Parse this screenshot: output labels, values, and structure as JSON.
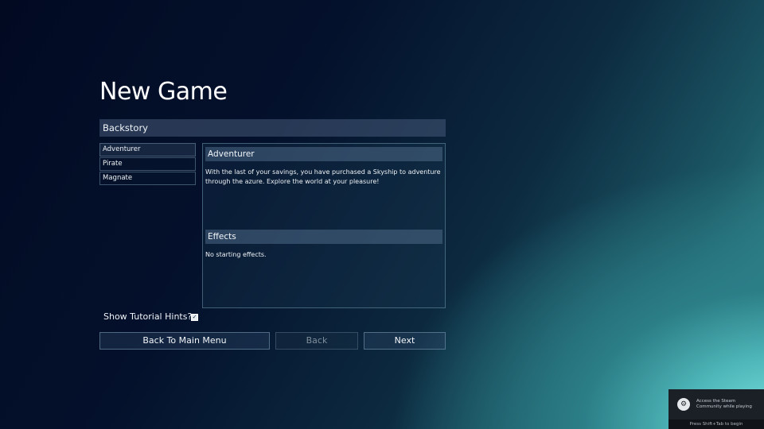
{
  "page": {
    "title": "New Game",
    "section_header": "Backstory"
  },
  "backstories": [
    {
      "label": "Adventurer",
      "selected": true
    },
    {
      "label": "Pirate",
      "selected": false
    },
    {
      "label": "Magnate",
      "selected": false
    }
  ],
  "detail": {
    "header": "Adventurer",
    "description": "With the last of your savings, you have purchased a Skyship to adventure through the azure. Explore the world at your pleasure!",
    "effects_header": "Effects",
    "effects_text": "No starting effects."
  },
  "tutorial": {
    "label": "Show Tutorial Hints?",
    "checked": true,
    "check_glyph": "✓"
  },
  "buttons": {
    "back_to_menu": "Back To Main Menu",
    "back": "Back",
    "next": "Next"
  },
  "steam_overlay": {
    "icon": "steam-icon",
    "message": "Access the Steam Community while playing",
    "footer": "Press Shift+Tab to begin"
  },
  "colors": {
    "background_dark": "#020a22",
    "background_teal": "#7ee6e4"
  }
}
